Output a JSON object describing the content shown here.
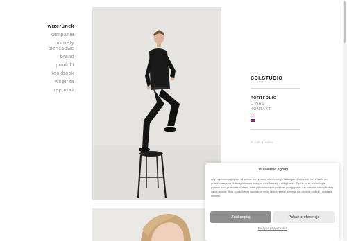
{
  "left_nav": {
    "items": [
      {
        "label": "wizerunek",
        "active": true
      },
      {
        "label": "kampanie",
        "active": false
      },
      {
        "label": "portrety biznesowe",
        "active": false
      },
      {
        "label": "brand",
        "active": false
      },
      {
        "label": "produkt",
        "active": false
      },
      {
        "label": "lookbook",
        "active": false
      },
      {
        "label": "wnętrza",
        "active": false
      },
      {
        "label": "reportaż",
        "active": false
      }
    ]
  },
  "studio": {
    "name": "CDI.STUDIO",
    "menu": [
      {
        "label": "PORTFOLIO",
        "active": true
      },
      {
        "label": "O NAS",
        "active": false
      },
      {
        "label": "KONTAKT",
        "active": false
      }
    ],
    "languages": [
      "pl-flag-icon",
      "gb-flag-icon"
    ],
    "note": "© cdi.studio"
  },
  "cookie": {
    "title": "Ustawienia zgody",
    "body": "Aby zapewnić najlepsze wrażenia, korzystamy z technologii, takich jak pliki cookie, które służą do przechowywania i/lub uzyskiwania dostępu do informacji o urządzeniu. Zgoda na te technologie pozwoli nam przetwarzać dane, takie jak zachowanie podczas przeglądania lub unikalne identyfikatory na tej stronie. Brak zgody lub jej wycofanie może niekorzystnie wpłynąć na niektóre funkcje i działanie serwisu.",
    "accept_label": "Zaakceptuj",
    "prefs_label": "Pokaż preferencje",
    "privacy_label": "Polityka prywatności"
  },
  "colors": {
    "accent": "#8e8e8e",
    "background": "#ffffff",
    "photo_bg": "#e7e5e1"
  }
}
